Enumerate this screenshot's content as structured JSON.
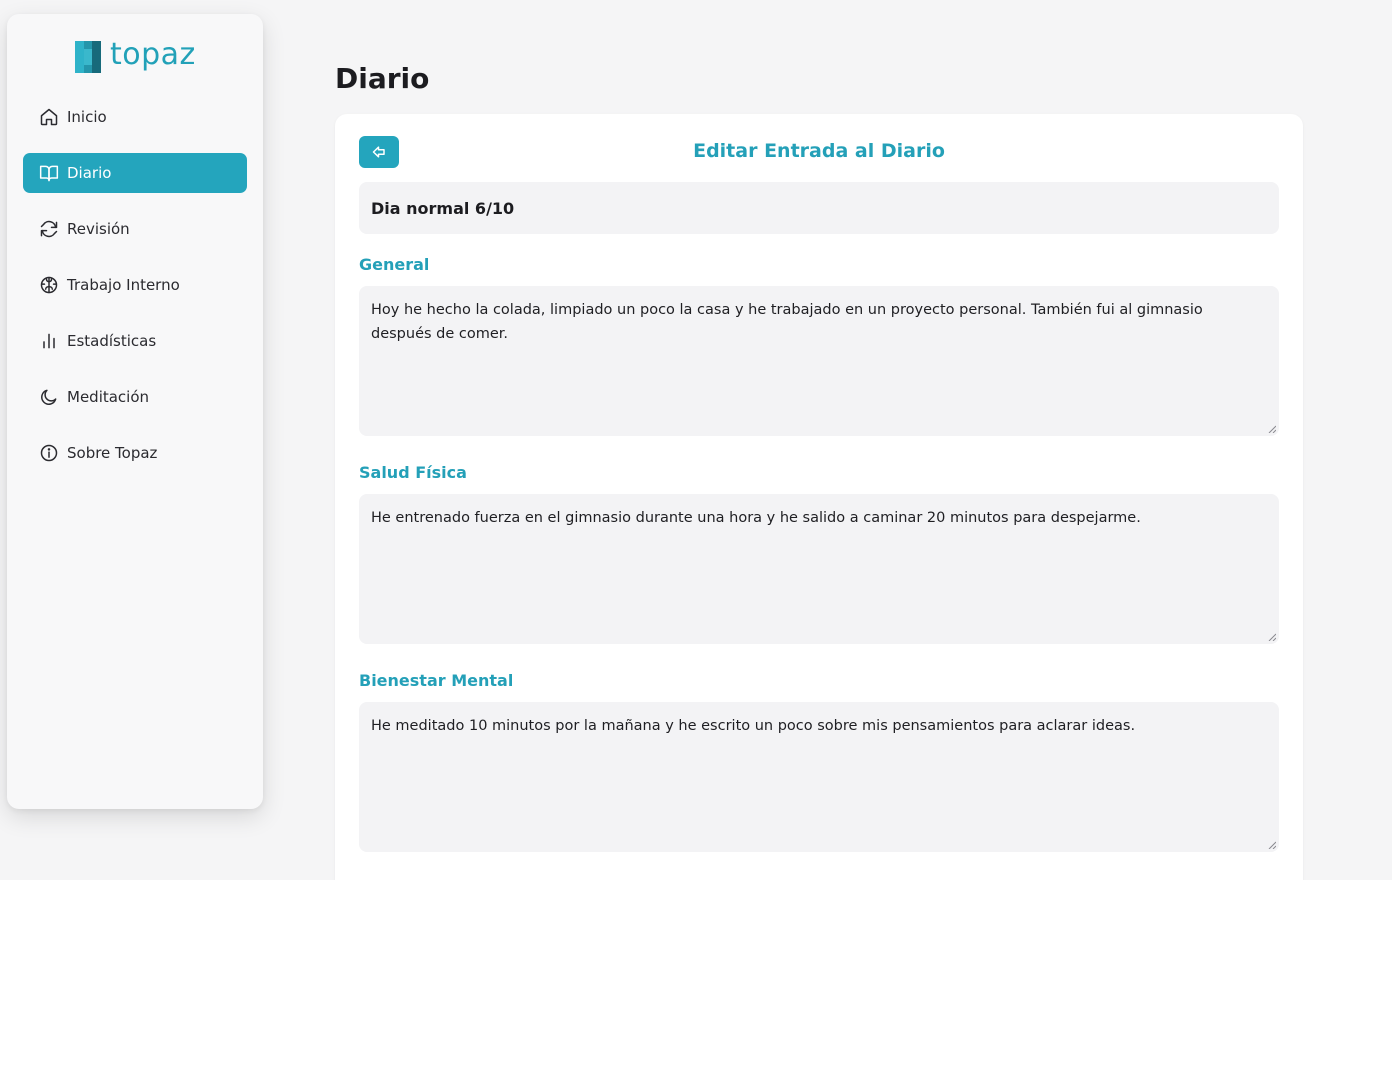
{
  "brand": {
    "name": "topaz",
    "accent": "#24a5bd"
  },
  "sidebar": {
    "items": [
      {
        "label": "Inicio",
        "icon": "home-icon",
        "active": false
      },
      {
        "label": "Diario",
        "icon": "book-open-icon",
        "active": true
      },
      {
        "label": "Revisión",
        "icon": "refresh-icon",
        "active": false
      },
      {
        "label": "Trabajo Interno",
        "icon": "brain-icon",
        "active": false
      },
      {
        "label": "Estadísticas",
        "icon": "bar-chart-icon",
        "active": false
      },
      {
        "label": "Meditación",
        "icon": "moon-icon",
        "active": false
      },
      {
        "label": "Sobre Topaz",
        "icon": "info-icon",
        "active": false
      }
    ]
  },
  "page": {
    "title": "Diario"
  },
  "editor": {
    "heading": "Editar Entrada al Diario",
    "back_icon": "arrow-left-icon",
    "entry_title": "Dia normal 6/10",
    "fields": [
      {
        "label": "General",
        "value": "Hoy he hecho la colada, limpiado un poco la casa y he trabajado en un proyecto personal. También fui al gimnasio después de comer."
      },
      {
        "label": "Salud Física",
        "value": "He entrenado fuerza en el gimnasio durante una hora y he salido a caminar 20 minutos para despejarme."
      },
      {
        "label": "Bienestar Mental",
        "value": "He meditado 10 minutos por la mañana y he escrito un poco sobre mis pensamientos para aclarar ideas."
      }
    ]
  }
}
